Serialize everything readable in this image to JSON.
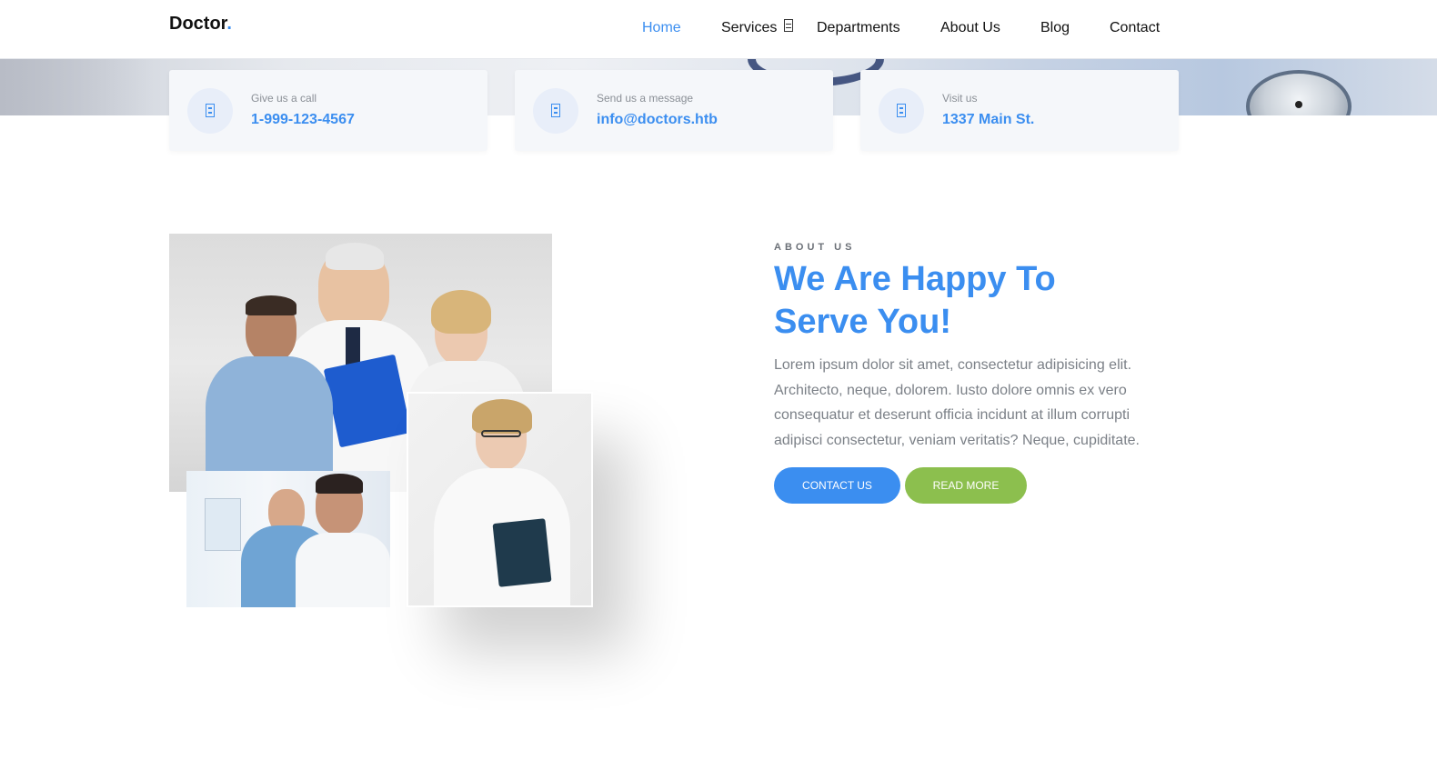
{
  "header": {
    "brand": "Doctor",
    "brand_dot": ".",
    "nav": [
      {
        "label": "Home",
        "active": true
      },
      {
        "label": "Services"
      },
      {
        "label": "Departments"
      },
      {
        "label": "About Us"
      },
      {
        "label": "Blog"
      },
      {
        "label": "Contact"
      }
    ]
  },
  "info_cards": [
    {
      "label": "Give us a call",
      "value": "1-999-123-4567",
      "icon": "phone-icon"
    },
    {
      "label": "Send us a message",
      "value": "info@doctors.htb",
      "icon": "message-icon"
    },
    {
      "label": "Visit us",
      "value": "1337 Main St.",
      "icon": "location-icon"
    }
  ],
  "about": {
    "tag": "ABOUT US",
    "title": "We Are Happy To Serve You!",
    "text": "Lorem ipsum dolor sit amet, consectetur adipisicing elit. Architecto, neque, dolorem. Iusto dolore omnis ex vero consequatur et deserunt officia incidunt at illum corrupti adipisci consectetur, veniam veritatis? Neque, cupiditate.",
    "contact_button": "CONTACT US",
    "read_more_button": "READ MORE"
  },
  "colors": {
    "accent": "#3b8ef0",
    "secondary_button": "#8cbf4e"
  }
}
